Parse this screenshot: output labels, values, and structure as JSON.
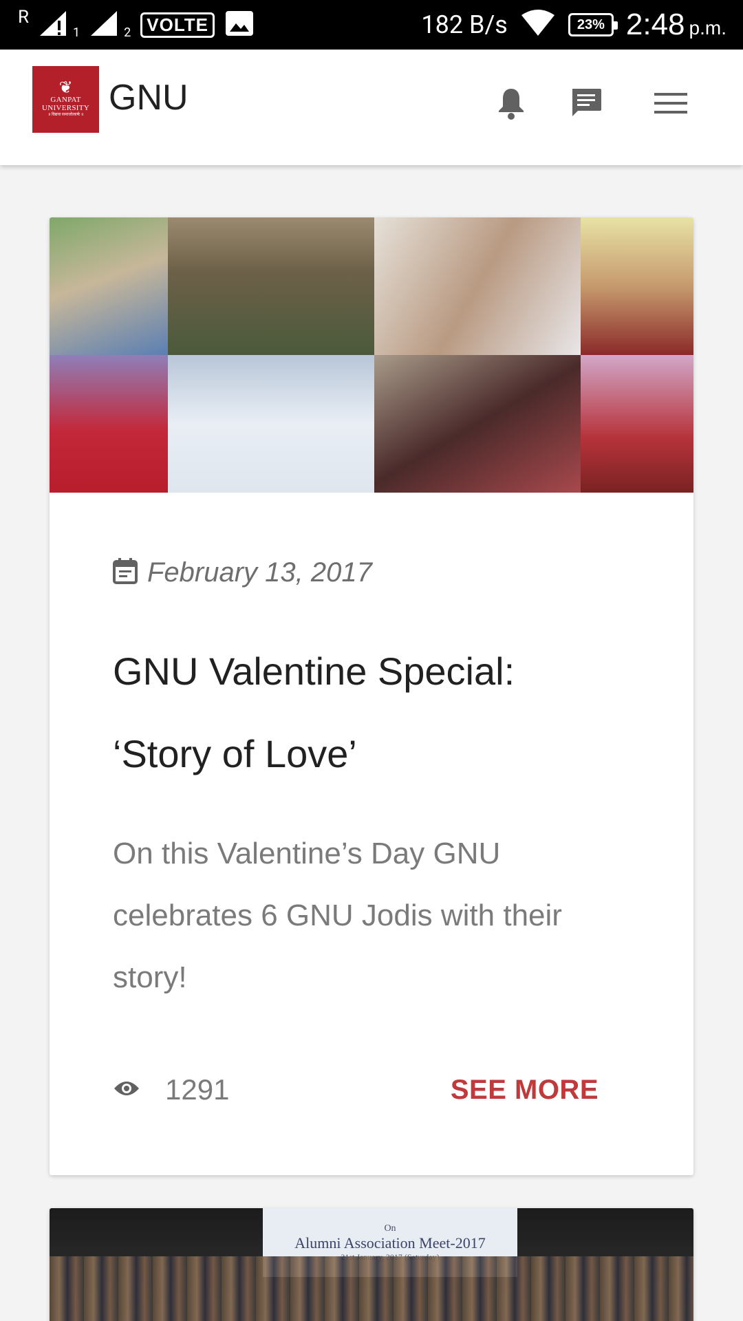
{
  "status_bar": {
    "roaming_mark": "R",
    "sim1_label": "1",
    "sim2_label": "2",
    "volte_label": "VOLTE",
    "net_speed": "182 B/s",
    "battery": "23%",
    "time": "2:48",
    "ampm": "p.m."
  },
  "app_bar": {
    "logo_line1": "GANPAT",
    "logo_line2": "UNIVERSITY",
    "logo_line3": "॥ विद्यया समाजोत्कर्षः ॥",
    "title": "GNU"
  },
  "posts": [
    {
      "date": "February 13, 2017",
      "title_line1": "GNU Valentine Special:",
      "title_line2": "‘Story of Love’",
      "excerpt": "On this Valentine’s Day GNU celebrates 6 GNU Jodis with their story!",
      "views": "1291",
      "cta": "SEE MORE"
    },
    {
      "banner_line1": "On",
      "banner_line2": "Alumni Association Meet-2017",
      "banner_line3": "21st January, 2017 (Saturday)"
    }
  ],
  "colors": {
    "accent": "#c0393b",
    "logo_bg": "#b3202a",
    "page_bg": "#f3f3f3"
  }
}
